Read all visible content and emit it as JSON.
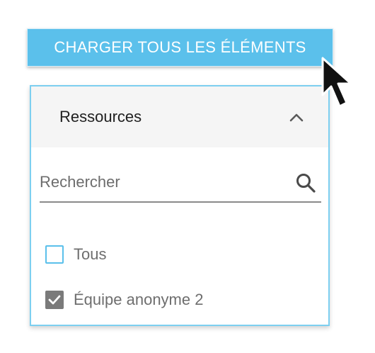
{
  "toolbar": {
    "load_all_label": "CHARGER TOUS LES ÉLÉMENTS"
  },
  "filter_panel": {
    "title": "Ressources",
    "expanded": true,
    "search": {
      "placeholder": "Rechercher",
      "value": ""
    },
    "options": [
      {
        "label": "Tous",
        "checked": false
      },
      {
        "label": "Équipe anonyme 2",
        "checked": true
      }
    ]
  },
  "colors": {
    "accent": "#5bc0eb",
    "panel_border": "#7dcff0",
    "checked_box": "#7a7a7a"
  },
  "icons": {
    "collapse": "chevron-up-icon",
    "search": "search-icon",
    "pointer": "mouse-cursor-icon",
    "check": "checkmark-icon"
  }
}
